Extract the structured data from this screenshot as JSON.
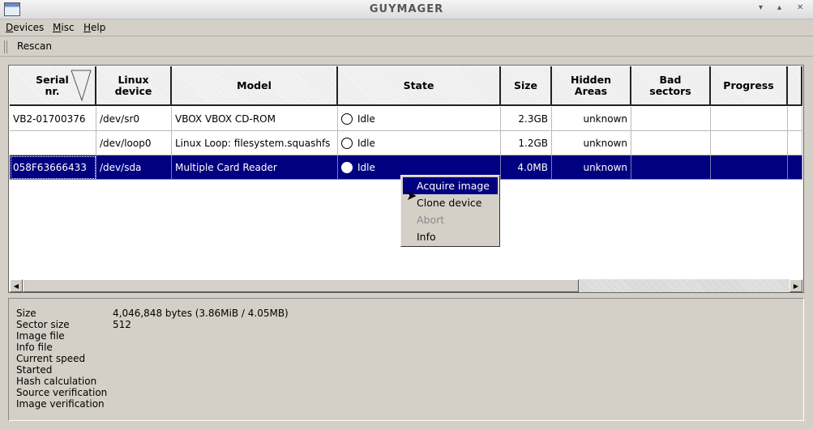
{
  "window": {
    "title": "GUYMAGER",
    "minimize": "▾",
    "maximize": "▴",
    "close": "✕"
  },
  "menubar": [
    {
      "label": "Devices",
      "accel": "D",
      "rest": "evices"
    },
    {
      "label": "Misc",
      "accel": "M",
      "rest": "isc"
    },
    {
      "label": "Help",
      "accel": "H",
      "rest": "elp"
    }
  ],
  "toolbar": {
    "rescan": "Rescan"
  },
  "table": {
    "columns": [
      "Serial nr.",
      "Linux device",
      "Model",
      "State",
      "Size",
      "Hidden Areas",
      "Bad sectors",
      "Progress",
      ""
    ],
    "column_lines": [
      [
        "Serial",
        "nr."
      ],
      [
        "Linux",
        "device"
      ],
      [
        "Model"
      ],
      [
        "State"
      ],
      [
        "Size"
      ],
      [
        "Hidden",
        "Areas"
      ],
      [
        "Bad",
        "sectors"
      ],
      [
        "Progress"
      ],
      [
        ""
      ]
    ],
    "rows": [
      {
        "serial": "VB2-01700376",
        "device": "/dev/sr0",
        "model": "VBOX VBOX CD-ROM",
        "state": "Idle",
        "size": "2.3GB",
        "hidden": "unknown",
        "bad": "",
        "progress": "",
        "selected": false
      },
      {
        "serial": "",
        "device": "/dev/loop0",
        "model": "Linux Loop: filesystem.squashfs",
        "state": "Idle",
        "size": "1.2GB",
        "hidden": "unknown",
        "bad": "",
        "progress": "",
        "selected": false
      },
      {
        "serial": "058F63666433",
        "device": "/dev/sda",
        "model": "Multiple Card  Reader",
        "state": "Idle",
        "size": "4.0MB",
        "hidden": "unknown",
        "bad": "",
        "progress": "",
        "selected": true
      }
    ]
  },
  "context_menu": [
    {
      "label": "Acquire image",
      "state": "highlighted"
    },
    {
      "label": "Clone device",
      "state": "normal"
    },
    {
      "label": "Abort",
      "state": "disabled"
    },
    {
      "label": "Info",
      "state": "normal"
    }
  ],
  "info": [
    {
      "label": "Size",
      "value": "4,046,848 bytes (3.86MiB / 4.05MB)"
    },
    {
      "label": "Sector size",
      "value": "512"
    },
    {
      "label": "Image file",
      "value": ""
    },
    {
      "label": "Info file",
      "value": ""
    },
    {
      "label": "Current speed",
      "value": ""
    },
    {
      "label": "Started",
      "value": ""
    },
    {
      "label": "Hash calculation",
      "value": ""
    },
    {
      "label": "Source verification",
      "value": ""
    },
    {
      "label": "Image verification",
      "value": ""
    }
  ],
  "colors": {
    "selection": "#000080",
    "background": "#d4d0c8"
  }
}
